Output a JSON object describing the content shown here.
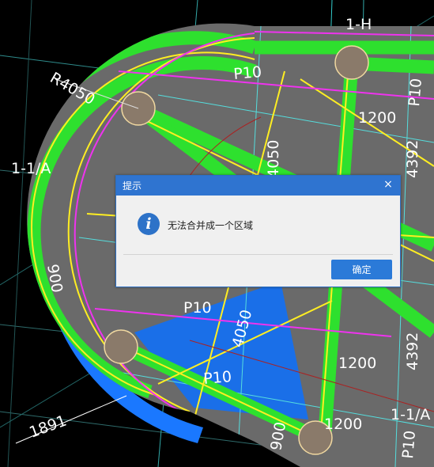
{
  "drawing": {
    "labels": {
      "radius": "R4050",
      "axis_1_1_A_left": "1-1/A",
      "axis_1_1_A_right": "1-1/A",
      "axis_1_H": "1-H",
      "p10_top": "P10",
      "p10_right": "P10",
      "p10_middle": "P10",
      "p10_lower": "P10",
      "p10_bottom_right": "P10",
      "dim_1200_top": "1200",
      "dim_1200_mid": "1200",
      "dim_1200_bottom": "1200",
      "dim_4392_top": "4392",
      "dim_4392_bottom": "4392",
      "dim_4050_top": "4050",
      "dim_4050_mid": "4050",
      "dim_900_left": "900",
      "dim_900_bottom": "900",
      "dim_1891": "1891"
    }
  },
  "dialog": {
    "title": "提示",
    "close_symbol": "×",
    "message": "无法合并成一个区域",
    "info_symbol": "i",
    "ok_label": "确定"
  }
}
